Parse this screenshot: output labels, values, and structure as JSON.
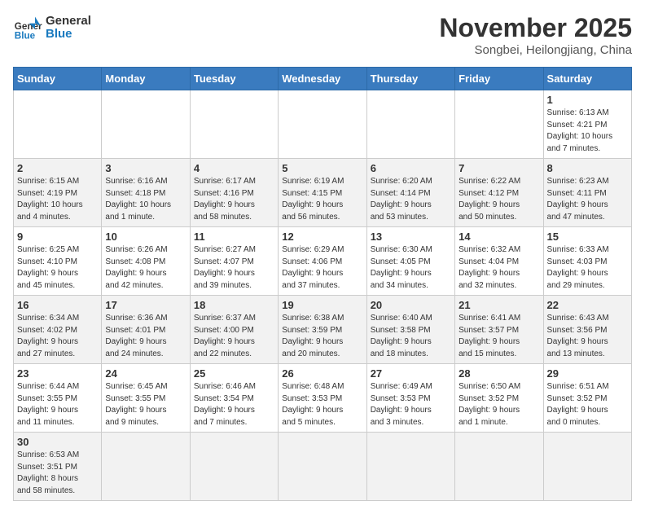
{
  "logo": {
    "text_general": "General",
    "text_blue": "Blue"
  },
  "header": {
    "month_year": "November 2025",
    "location": "Songbei, Heilongjiang, China"
  },
  "weekdays": [
    "Sunday",
    "Monday",
    "Tuesday",
    "Wednesday",
    "Thursday",
    "Friday",
    "Saturday"
  ],
  "weeks": [
    [
      {
        "day": "",
        "info": ""
      },
      {
        "day": "",
        "info": ""
      },
      {
        "day": "",
        "info": ""
      },
      {
        "day": "",
        "info": ""
      },
      {
        "day": "",
        "info": ""
      },
      {
        "day": "",
        "info": ""
      },
      {
        "day": "1",
        "info": "Sunrise: 6:13 AM\nSunset: 4:21 PM\nDaylight: 10 hours\nand 7 minutes."
      }
    ],
    [
      {
        "day": "2",
        "info": "Sunrise: 6:15 AM\nSunset: 4:19 PM\nDaylight: 10 hours\nand 4 minutes."
      },
      {
        "day": "3",
        "info": "Sunrise: 6:16 AM\nSunset: 4:18 PM\nDaylight: 10 hours\nand 1 minute."
      },
      {
        "day": "4",
        "info": "Sunrise: 6:17 AM\nSunset: 4:16 PM\nDaylight: 9 hours\nand 58 minutes."
      },
      {
        "day": "5",
        "info": "Sunrise: 6:19 AM\nSunset: 4:15 PM\nDaylight: 9 hours\nand 56 minutes."
      },
      {
        "day": "6",
        "info": "Sunrise: 6:20 AM\nSunset: 4:14 PM\nDaylight: 9 hours\nand 53 minutes."
      },
      {
        "day": "7",
        "info": "Sunrise: 6:22 AM\nSunset: 4:12 PM\nDaylight: 9 hours\nand 50 minutes."
      },
      {
        "day": "8",
        "info": "Sunrise: 6:23 AM\nSunset: 4:11 PM\nDaylight: 9 hours\nand 47 minutes."
      }
    ],
    [
      {
        "day": "9",
        "info": "Sunrise: 6:25 AM\nSunset: 4:10 PM\nDaylight: 9 hours\nand 45 minutes."
      },
      {
        "day": "10",
        "info": "Sunrise: 6:26 AM\nSunset: 4:08 PM\nDaylight: 9 hours\nand 42 minutes."
      },
      {
        "day": "11",
        "info": "Sunrise: 6:27 AM\nSunset: 4:07 PM\nDaylight: 9 hours\nand 39 minutes."
      },
      {
        "day": "12",
        "info": "Sunrise: 6:29 AM\nSunset: 4:06 PM\nDaylight: 9 hours\nand 37 minutes."
      },
      {
        "day": "13",
        "info": "Sunrise: 6:30 AM\nSunset: 4:05 PM\nDaylight: 9 hours\nand 34 minutes."
      },
      {
        "day": "14",
        "info": "Sunrise: 6:32 AM\nSunset: 4:04 PM\nDaylight: 9 hours\nand 32 minutes."
      },
      {
        "day": "15",
        "info": "Sunrise: 6:33 AM\nSunset: 4:03 PM\nDaylight: 9 hours\nand 29 minutes."
      }
    ],
    [
      {
        "day": "16",
        "info": "Sunrise: 6:34 AM\nSunset: 4:02 PM\nDaylight: 9 hours\nand 27 minutes."
      },
      {
        "day": "17",
        "info": "Sunrise: 6:36 AM\nSunset: 4:01 PM\nDaylight: 9 hours\nand 24 minutes."
      },
      {
        "day": "18",
        "info": "Sunrise: 6:37 AM\nSunset: 4:00 PM\nDaylight: 9 hours\nand 22 minutes."
      },
      {
        "day": "19",
        "info": "Sunrise: 6:38 AM\nSunset: 3:59 PM\nDaylight: 9 hours\nand 20 minutes."
      },
      {
        "day": "20",
        "info": "Sunrise: 6:40 AM\nSunset: 3:58 PM\nDaylight: 9 hours\nand 18 minutes."
      },
      {
        "day": "21",
        "info": "Sunrise: 6:41 AM\nSunset: 3:57 PM\nDaylight: 9 hours\nand 15 minutes."
      },
      {
        "day": "22",
        "info": "Sunrise: 6:43 AM\nSunset: 3:56 PM\nDaylight: 9 hours\nand 13 minutes."
      }
    ],
    [
      {
        "day": "23",
        "info": "Sunrise: 6:44 AM\nSunset: 3:55 PM\nDaylight: 9 hours\nand 11 minutes."
      },
      {
        "day": "24",
        "info": "Sunrise: 6:45 AM\nSunset: 3:55 PM\nDaylight: 9 hours\nand 9 minutes."
      },
      {
        "day": "25",
        "info": "Sunrise: 6:46 AM\nSunset: 3:54 PM\nDaylight: 9 hours\nand 7 minutes."
      },
      {
        "day": "26",
        "info": "Sunrise: 6:48 AM\nSunset: 3:53 PM\nDaylight: 9 hours\nand 5 minutes."
      },
      {
        "day": "27",
        "info": "Sunrise: 6:49 AM\nSunset: 3:53 PM\nDaylight: 9 hours\nand 3 minutes."
      },
      {
        "day": "28",
        "info": "Sunrise: 6:50 AM\nSunset: 3:52 PM\nDaylight: 9 hours\nand 1 minute."
      },
      {
        "day": "29",
        "info": "Sunrise: 6:51 AM\nSunset: 3:52 PM\nDaylight: 9 hours\nand 0 minutes."
      }
    ],
    [
      {
        "day": "30",
        "info": "Sunrise: 6:53 AM\nSunset: 3:51 PM\nDaylight: 8 hours\nand 58 minutes."
      },
      {
        "day": "",
        "info": ""
      },
      {
        "day": "",
        "info": ""
      },
      {
        "day": "",
        "info": ""
      },
      {
        "day": "",
        "info": ""
      },
      {
        "day": "",
        "info": ""
      },
      {
        "day": "",
        "info": ""
      }
    ]
  ]
}
